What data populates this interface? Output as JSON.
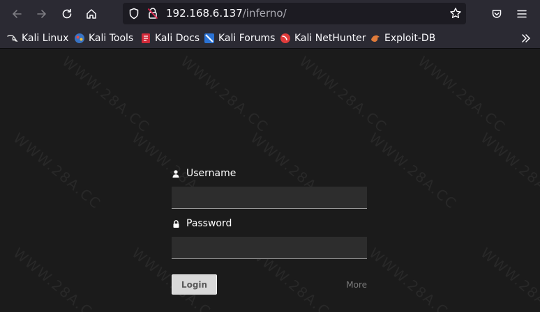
{
  "browser": {
    "url_host": "192.168.6.137",
    "url_path": "/inferno/",
    "bookmarks": [
      {
        "label": "Kali Linux",
        "icon": "kali-dragon-icon"
      },
      {
        "label": "Kali Tools",
        "icon": "kali-tools-icon"
      },
      {
        "label": "Kali Docs",
        "icon": "kali-docs-icon"
      },
      {
        "label": "Kali Forums",
        "icon": "kali-forums-icon"
      },
      {
        "label": "Kali NetHunter",
        "icon": "nethunter-icon"
      },
      {
        "label": "Exploit-DB",
        "icon": "exploit-db-icon"
      }
    ]
  },
  "login": {
    "username_label": "Username",
    "password_label": "Password",
    "username_value": "",
    "password_value": "",
    "login_button": "Login",
    "more_link": "More"
  },
  "watermark": "WWW.28A.CC",
  "colors": {
    "chrome": "#2b2a33",
    "page_bg": "#1b1b1b",
    "input_bg": "#2d2d2d",
    "button_bg": "#d9d9d9"
  }
}
